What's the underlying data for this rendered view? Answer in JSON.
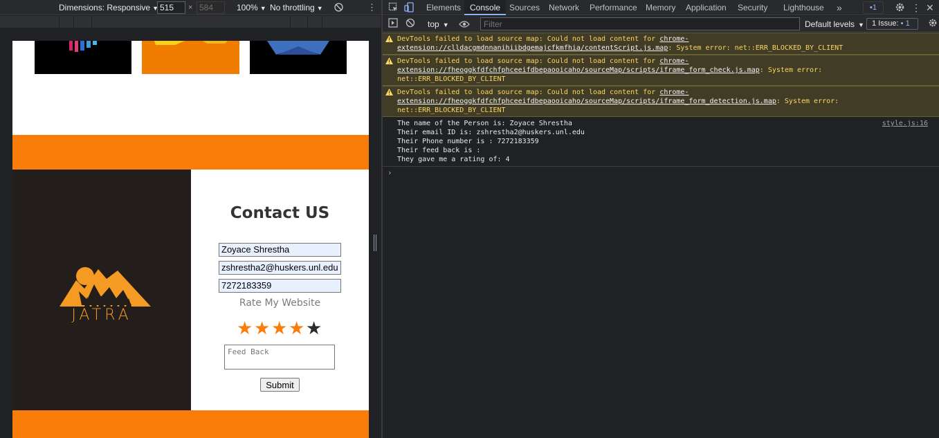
{
  "device_toolbar": {
    "dimensions_label": "Dimensions: Responsive",
    "width": "515",
    "height": "584",
    "zoom": "100%",
    "throttling": "No throttling",
    "times": "×"
  },
  "page": {
    "contact_title": "Contact US",
    "name_value": "Zoyace Shrestha",
    "email_value": "zshrestha2@huskers.unl.edu",
    "phone_value": "7272183359",
    "rate_label": "Rate My Website",
    "rating": 4,
    "rating_max": 5,
    "feedback_placeholder": "Feed Back",
    "submit_label": "Submit",
    "logo_text": "JATRA",
    "colors": {
      "accent": "#fa7d09",
      "dark": "#231e1c",
      "star_off": "#2b2b2b"
    }
  },
  "devtools": {
    "tabs": [
      "Elements",
      "Console",
      "Sources",
      "Network",
      "Performance",
      "Memory",
      "Application",
      "Security",
      "Lighthouse"
    ],
    "active_tab": "Console",
    "issues_badge": "1",
    "context": "top",
    "filter_placeholder": "Filter",
    "levels": "Default levels",
    "issue_label": "1 Issue:",
    "issue_count": "1",
    "warnings": [
      {
        "prefix": "DevTools failed to load source map: Could not load content for ",
        "link": "chrome-extension://clldacgmdnnanihiibdgemajcfkmfhia/contentScript.js.map",
        "suffix": ": System error: net::ERR_BLOCKED_BY_CLIENT"
      },
      {
        "prefix": "DevTools failed to load source map: Could not load content for ",
        "link": "chrome-extension://fheoggkfdfchfphceeifdbepaooicaho/sourceMap/scripts/iframe_form_check.js.map",
        "suffix": ": System error: net::ERR_BLOCKED_BY_CLIENT"
      },
      {
        "prefix": "DevTools failed to load source map: Could not load content for ",
        "link": "chrome-extension://fheoggkfdfchfphceeifdbepaooicaho/sourceMap/scripts/iframe_form_detection.js.map",
        "suffix": ": System error: net::ERR_BLOCKED_BY_CLIENT"
      }
    ],
    "log_lines": [
      "The name of the Person is: Zoyace Shrestha",
      "Their email ID is: zshrestha2@huskers.unl.edu",
      "Their Phone number is : 7272183359",
      "Their feed back is :",
      "They gave me a rating of: 4"
    ],
    "log_source": "style.js:16",
    "prompt_symbol": "›"
  }
}
